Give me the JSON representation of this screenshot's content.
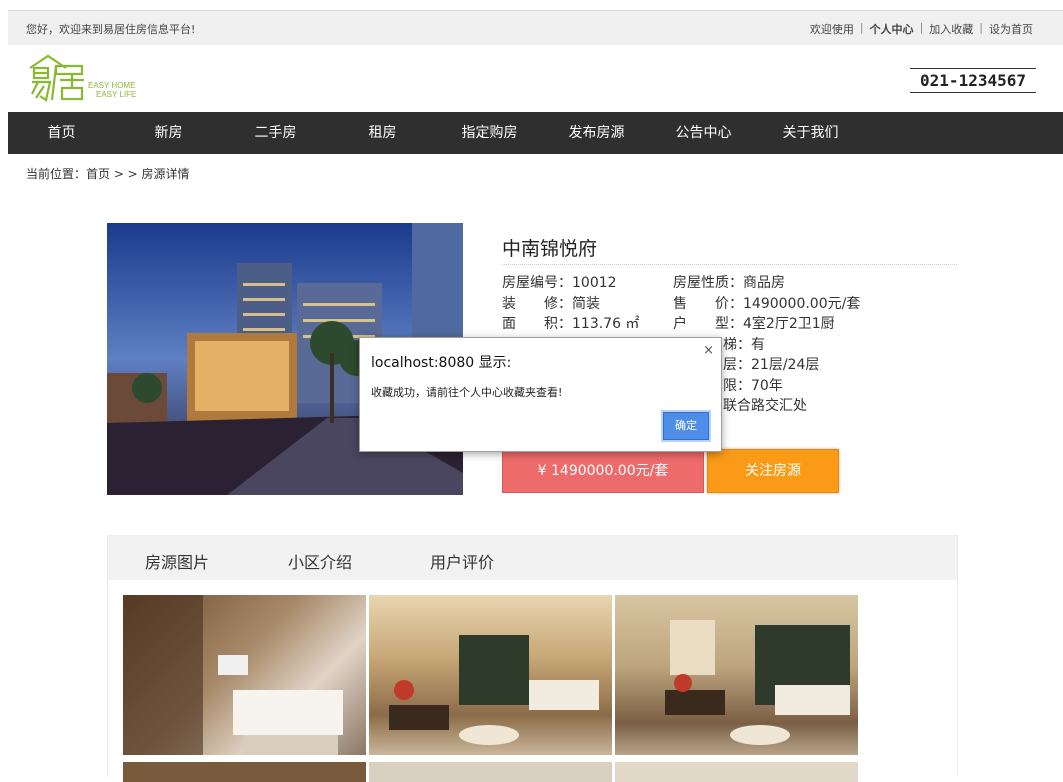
{
  "topbar": {
    "greeting": "您好，欢迎来到易居住房信息平台!",
    "welcome": "欢迎使用",
    "personal_center": "个人中心",
    "add_favorite": "加入收藏",
    "set_home": "设为首页"
  },
  "logo": {
    "text_zh": "易居",
    "text_en_1": "EASY HOME",
    "text_en_2": "EASY LIFE"
  },
  "phone": "021-1234567",
  "nav": {
    "items": [
      "首页",
      "新房",
      "二手房",
      "租房",
      "指定购房",
      "发布房源",
      "公告中心",
      "关于我们"
    ]
  },
  "breadcrumb": "当前位置：首页 > > 房源详情",
  "property": {
    "title": "中南锦悦府",
    "left": [
      {
        "label": "房屋编号：",
        "value": "10012"
      },
      {
        "label": "装　　修：",
        "value": "简装"
      },
      {
        "label": "面　　积：",
        "value": "113.76 ㎡"
      }
    ],
    "right": [
      {
        "label": "房屋性质：",
        "value": "商品房"
      },
      {
        "label": "售　　价：",
        "value": "1490000.00元/套"
      },
      {
        "label": "户　　型：",
        "value": "4室2厅2卫1厨"
      },
      {
        "label": "梯：",
        "value": "有"
      },
      {
        "label": "层：",
        "value": "21层/24层"
      },
      {
        "label": "限：",
        "value": "70年"
      },
      {
        "label": "",
        "value": "联合路交汇处"
      }
    ],
    "price_button": "¥ 1490000.00元/套",
    "follow_button": "关注房源"
  },
  "dialog": {
    "title": "localhost:8080 显示:",
    "message": "收藏成功，请前往个人中心收藏夹查看!",
    "ok": "确定",
    "close": "×"
  },
  "tabs": [
    "房源图片",
    "小区介绍",
    "用户评价"
  ],
  "colors": {
    "nav_bg": "#2f2f2f",
    "price_btn": "#ee6b6b",
    "follow_btn": "#fb9a17",
    "logo_green": "#8ab832",
    "dialog_ok": "#4e8ee8"
  }
}
